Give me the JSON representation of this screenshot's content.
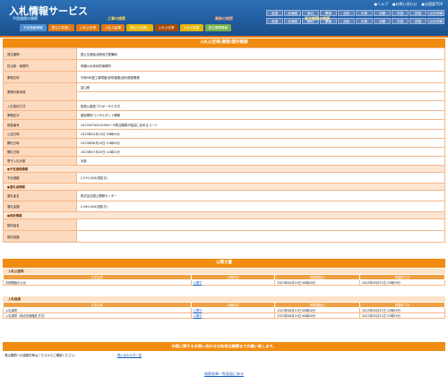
{
  "app_title": "入札情報サービス",
  "header_links": [
    "●ヘルプ",
    "●お問い合わせ",
    "●全国版TOP"
  ],
  "regions_row1": [
    "全国",
    "北海道",
    "東北",
    "関東",
    "北陸",
    "中部",
    "近畿",
    "中国",
    "四国",
    "九州沖縄"
  ],
  "regions_row2": [
    "全国",
    "北海道",
    "東北",
    "関東",
    "北陸",
    "中部",
    "近畿",
    "中国",
    "四国",
    "九州沖縄"
  ],
  "groups": [
    "予定価格の検索",
    "工事の検索",
    "業務の検索",
    "発注機関の検索"
  ],
  "tabs": [
    "予定価格情報",
    "発注の見通し",
    "入札公告等",
    "入札の結果",
    "発注の見通し",
    "入札公告等",
    "入札の結果",
    "発注機関情報"
  ],
  "panel_title": "入札公告等(業務)案件概要",
  "details": [
    {
      "k": "発注機関",
      "v": "国土交通省北陸地方整備局"
    },
    {
      "k": "担当部・事務所",
      "v": "神通川水系砂防事務所"
    },
    {
      "k": "業務名称",
      "v": "令和5年度工事関連(砂防堰堤)設計調査業務"
    },
    {
      "k": "業務対象地域",
      "v": "富山県"
    },
    {
      "k": "",
      "v": ""
    },
    {
      "k": "入札契約方式",
      "v": "簡易公募型プロポーザル方式"
    },
    {
      "k": "業務区分",
      "v": "建設関係コンサルタント業務"
    },
    {
      "k": "業種分類",
      "v": "土木関係建設コンサルタント業務"
    },
    {
      "k": "調査番号",
      "v": "2023007002019007 ※発注機関が独自に定めるコード"
    },
    {
      "k": "公告日時",
      "v": "2023年04月14日 00時00分"
    },
    {
      "k": "開札日時",
      "v": "2023年06月23日 12時00分"
    },
    {
      "k": "開札日時",
      "v": "2023年07月20日 11時22分"
    },
    {
      "k": "電子入札対象",
      "v": "対象"
    }
  ],
  "section_price": "●予定価格情報",
  "price": {
    "k": "予定価格",
    "v": "2,970,000(税抜き)"
  },
  "section_winner": "●落札者情報",
  "winner": [
    {
      "k": "落札者名",
      "v": "株式会社国土開発センター"
    },
    {
      "k": "落札金額",
      "v": "2,940,000(税抜き)"
    }
  ],
  "section_contract": "●契約情報",
  "contract": [
    {
      "k": "契約者名",
      "v": ""
    },
    {
      "k": "契約金額",
      "v": ""
    }
  ],
  "docs": {
    "title": "公開文書",
    "notice_header": "入札公告等",
    "columns": [
      "文書名称",
      "公開状況",
      "掲載開始日",
      "掲載終了日"
    ],
    "notice_rows": [
      {
        "name": "手続開始の公示",
        "status": "公開中",
        "start": "2023年04月14日 00時00分",
        "end": "2023年05月31日 23時59分"
      }
    ],
    "result_header": "入札経過",
    "result_rows": [
      {
        "name": "入札調書",
        "status": "公開中",
        "start": "2023年08月14日 00時00分",
        "end": "2023年05月31日 23時59分"
      },
      {
        "name": "入札調書（総合評価落札方式）",
        "status": "公開中",
        "start": "2023年08月14日 00時00分",
        "end": "2023年05月31日 23時59分"
      }
    ]
  },
  "contact_bar": "内容に関するお問い合わせは各発注機関までお願い致します。",
  "contact_text": "発注機関への連絡先等はこちらからご確認ください。",
  "contact_link": "問い合わせ先一覧",
  "back_link": "検索結果一覧画面に戻る",
  "colors": {
    "header": "#1b4f8e",
    "accent": "#f08c10",
    "row": "#fdd9be"
  }
}
